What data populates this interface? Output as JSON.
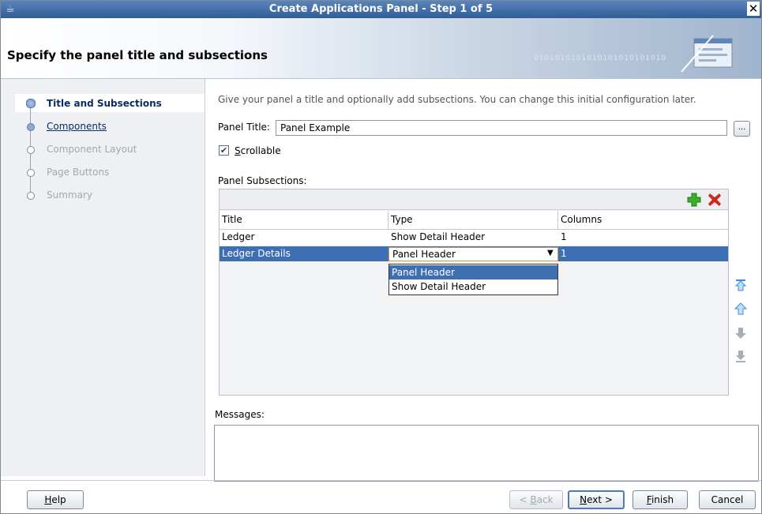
{
  "window": {
    "title": "Create Applications Panel - Step 1 of 5",
    "close_glyph": "✕"
  },
  "header": {
    "title": "Specify the panel title and subsections",
    "decor_binary": "0101010101010101010101010"
  },
  "nav": {
    "items": [
      {
        "label": "Title and Subsections",
        "state": "current"
      },
      {
        "label": "Components",
        "state": "link"
      },
      {
        "label": "Component Layout",
        "state": "disabled"
      },
      {
        "label": "Page Buttons",
        "state": "disabled"
      },
      {
        "label": "Summary",
        "state": "disabled"
      }
    ]
  },
  "main": {
    "description": "Give your panel a title and optionally add subsections. You can change this initial configuration later.",
    "panel_title_label": "Panel Title:",
    "panel_title_value": "Panel Example",
    "ellipsis_label": "...",
    "scrollable_label_u": "S",
    "scrollable_label_rest": "crollable",
    "scrollable_checked": true,
    "subsections_label": "Panel Subsections:",
    "table": {
      "columns": [
        "Title",
        "Type",
        "Columns"
      ],
      "rows": [
        {
          "title": "Ledger",
          "type": "Show Detail Header",
          "columns": "1"
        },
        {
          "title": "Ledger Details",
          "type": "Panel Header",
          "columns": "1"
        }
      ],
      "dropdown_options": [
        "Panel Header",
        "Show Detail Header"
      ]
    },
    "messages_label": "Messages:"
  },
  "buttons": {
    "help_u": "H",
    "help_rest": "elp",
    "back_pre": "< ",
    "back_u": "B",
    "back_rest": "ack",
    "next_u": "N",
    "next_rest": "ext >",
    "finish_u": "F",
    "finish_rest": "inish",
    "cancel": "Cancel"
  },
  "colors": {
    "titlebar": "#3f6ca5",
    "selection": "#3e6fb3",
    "nav_text": "#0b2d63",
    "add_icon": "#3cae2c",
    "delete_icon": "#d0271d",
    "move_icon": "#3a8fd8"
  }
}
